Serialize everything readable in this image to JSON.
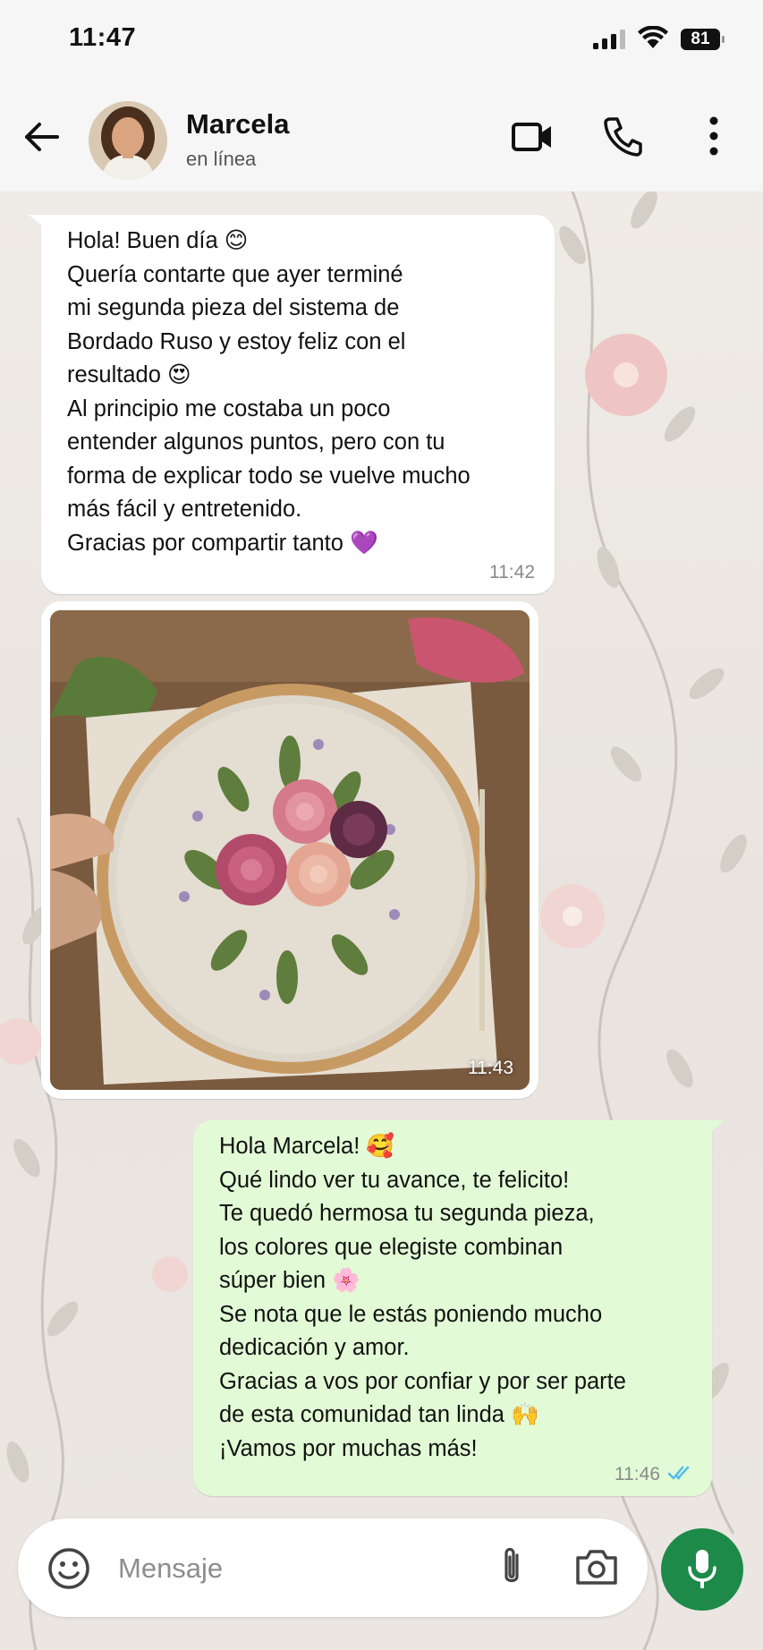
{
  "status_bar": {
    "time": "11:47",
    "battery": "81",
    "icons": [
      "signal-icon",
      "wifi-icon",
      "battery-icon"
    ]
  },
  "header": {
    "contact_name": "Marcela",
    "contact_status": "en línea",
    "icons": [
      "back-arrow-icon",
      "video-call-icon",
      "phone-icon",
      "more-vertical-icon"
    ]
  },
  "messages": [
    {
      "direction": "incoming",
      "text": "Hola! Buen día 😊\nQuería contarte que ayer terminé\nmi segunda pieza del sistema de\nBordado Ruso y estoy feliz con el\nresultado 😍\nAl principio me costaba un poco\nentender algunos puntos, pero con tu\nforma de explicar todo se vuelve mucho\nmás fácil y entretenido.\nGracias por compartir tanto 💜",
      "time": "11:42"
    },
    {
      "direction": "incoming",
      "type": "image",
      "image_subject": "embroidery-hoop-photo",
      "time": "11:43"
    },
    {
      "direction": "outgoing",
      "text": "Hola Marcela! 🥰\nQué lindo ver tu avance, te felicito!\nTe quedó hermosa tu segunda pieza,\nlos colores que elegiste combinan\nsúper bien 🌸\nSe nota que le estás poniendo mucho\ndedicación y amor.\nGracias a vos por confiar y por ser parte\nde esta comunidad tan linda 🙌\n¡Vamos por muchas más!",
      "time": "11:46",
      "status": "read"
    }
  ],
  "composer": {
    "placeholder": "Mensaje",
    "value": "",
    "icons": [
      "emoji-icon",
      "attach-icon",
      "camera-icon",
      "mic-icon"
    ]
  },
  "colors": {
    "bar_bg": "#f6f6f6",
    "incoming_bubble": "#ffffff",
    "outgoing_bubble": "#e2fbd6",
    "read_ticks": "#53bdeb",
    "mic_button": "#1d8a4a",
    "wallpaper": "#ece7e1"
  }
}
